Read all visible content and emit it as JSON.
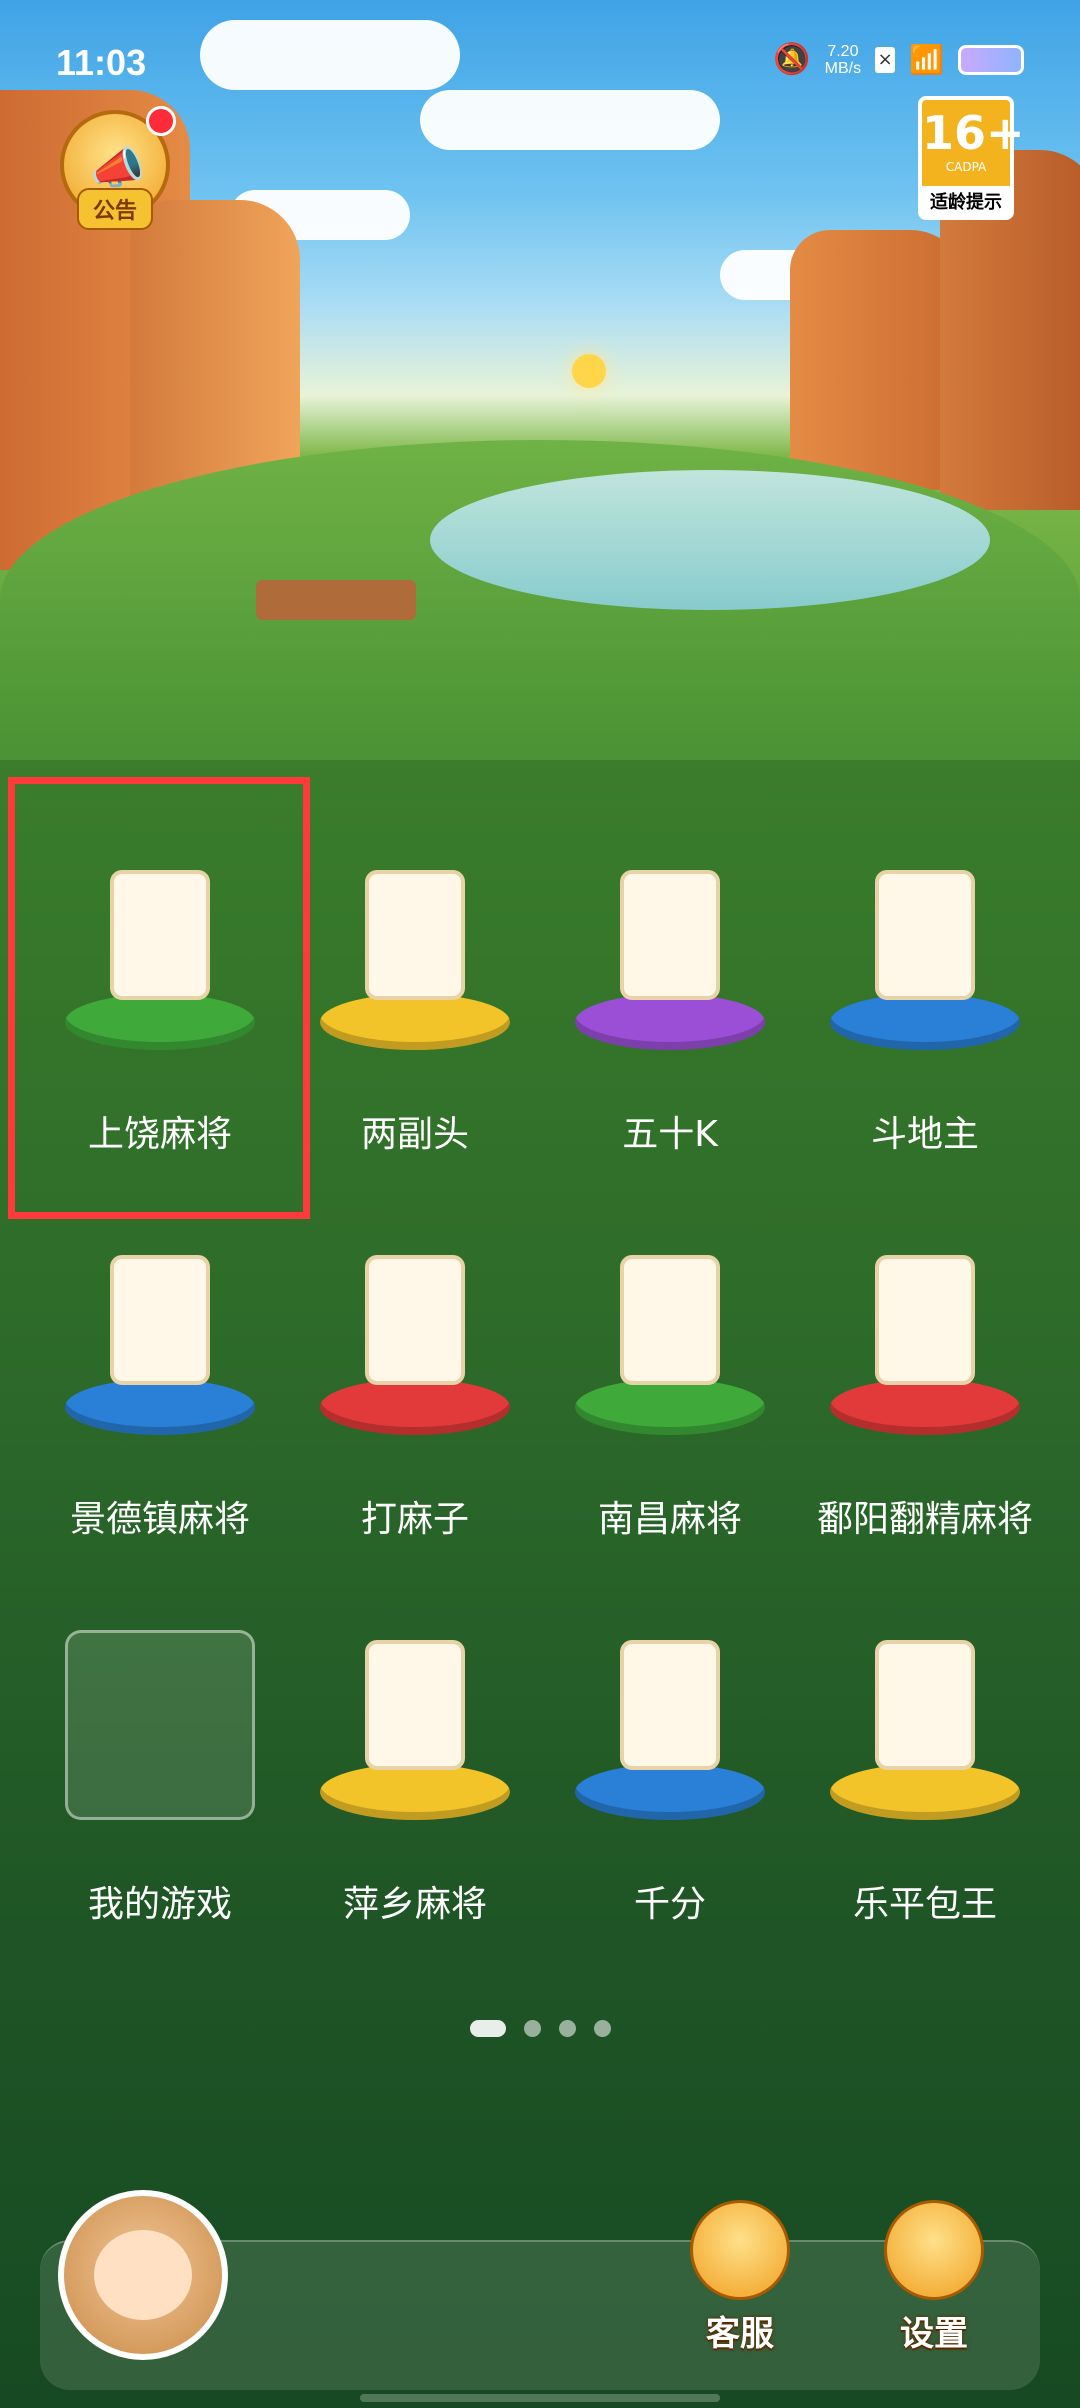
{
  "status_bar": {
    "time": "11:03",
    "speed_value": "7.20",
    "speed_unit": "MB/s"
  },
  "notice": {
    "label": "公告"
  },
  "age_badge": {
    "rating": "16+",
    "org": "CADPA",
    "text": "适龄提示"
  },
  "games": [
    {
      "label": "上饶麻将",
      "base_color": "#3faa3a"
    },
    {
      "label": "两副头",
      "base_color": "#f3c429"
    },
    {
      "label": "五十K",
      "base_color": "#9b4fd6"
    },
    {
      "label": "斗地主",
      "base_color": "#2a7fd6"
    },
    {
      "label": "景德镇麻将",
      "base_color": "#2a7fd6"
    },
    {
      "label": "打麻子",
      "base_color": "#e23a3a"
    },
    {
      "label": "南昌麻将",
      "base_color": "#3faa3a"
    },
    {
      "label": "鄱阳翻精麻将",
      "base_color": "#e23a3a"
    },
    {
      "label": "我的游戏",
      "base_color": "transparent"
    },
    {
      "label": "萍乡麻将",
      "base_color": "#f3c429"
    },
    {
      "label": "千分",
      "base_color": "#2a7fd6"
    },
    {
      "label": "乐平包王",
      "base_color": "#f3c429"
    }
  ],
  "bottom": {
    "service_label": "客服",
    "settings_label": "设置"
  },
  "icons": {
    "notice": "megaphone-icon",
    "service": "headset-icon",
    "settings": "gear-icon"
  }
}
